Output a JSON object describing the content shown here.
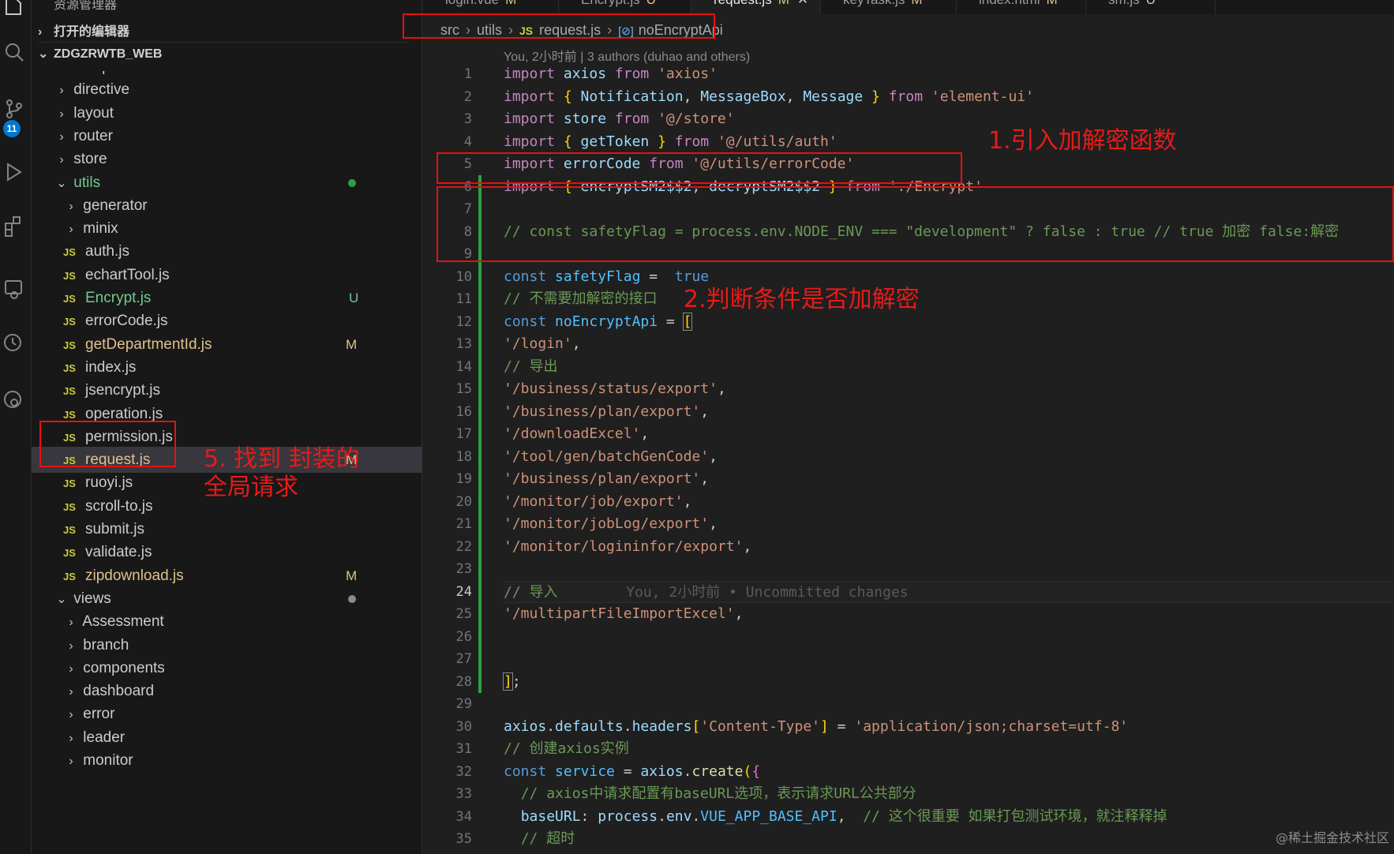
{
  "sidebar": {
    "title": "资源管理器",
    "open_editors": "打开的编辑器",
    "project": "ZDGZRWTB_WEB",
    "tree": [
      {
        "label": "components",
        "type": "folder",
        "depth": 1,
        "open": true
      },
      {
        "label": "directive",
        "type": "folder",
        "depth": 1,
        "open": false
      },
      {
        "label": "layout",
        "type": "folder",
        "depth": 1,
        "open": false
      },
      {
        "label": "router",
        "type": "folder",
        "depth": 1,
        "open": false
      },
      {
        "label": "store",
        "type": "folder",
        "depth": 1,
        "open": false
      },
      {
        "label": "utils",
        "type": "folder",
        "depth": 1,
        "open": true,
        "dot": true,
        "color": "green"
      },
      {
        "label": "generator",
        "type": "folder",
        "depth": 2,
        "open": false
      },
      {
        "label": "minix",
        "type": "folder",
        "depth": 2,
        "open": false
      },
      {
        "label": "auth.js",
        "type": "file",
        "depth": 2
      },
      {
        "label": "echartTool.js",
        "type": "file",
        "depth": 2
      },
      {
        "label": "Encrypt.js",
        "type": "file",
        "depth": 2,
        "status": "U"
      },
      {
        "label": "errorCode.js",
        "type": "file",
        "depth": 2
      },
      {
        "label": "getDepartmentId.js",
        "type": "file",
        "depth": 2,
        "status": "M"
      },
      {
        "label": "index.js",
        "type": "file",
        "depth": 2
      },
      {
        "label": "jsencrypt.js",
        "type": "file",
        "depth": 2
      },
      {
        "label": "operation.js",
        "type": "file",
        "depth": 2
      },
      {
        "label": "permission.js",
        "type": "file",
        "depth": 2
      },
      {
        "label": "request.js",
        "type": "file",
        "depth": 2,
        "status": "M",
        "selected": true
      },
      {
        "label": "ruoyi.js",
        "type": "file",
        "depth": 2
      },
      {
        "label": "scroll-to.js",
        "type": "file",
        "depth": 2
      },
      {
        "label": "submit.js",
        "type": "file",
        "depth": 2
      },
      {
        "label": "validate.js",
        "type": "file",
        "depth": 2
      },
      {
        "label": "zipdownload.js",
        "type": "file",
        "depth": 2,
        "status": "M"
      },
      {
        "label": "views",
        "type": "folder",
        "depth": 1,
        "open": true,
        "dot": true,
        "color": "grey"
      },
      {
        "label": "Assessment",
        "type": "folder",
        "depth": 2,
        "open": false
      },
      {
        "label": "branch",
        "type": "folder",
        "depth": 2,
        "open": false
      },
      {
        "label": "components",
        "type": "folder",
        "depth": 2,
        "open": false
      },
      {
        "label": "dashboard",
        "type": "folder",
        "depth": 2,
        "open": false
      },
      {
        "label": "error",
        "type": "folder",
        "depth": 2,
        "open": false
      },
      {
        "label": "leader",
        "type": "folder",
        "depth": 2,
        "open": false
      },
      {
        "label": "monitor",
        "type": "folder",
        "depth": 2,
        "open": false
      }
    ]
  },
  "activity": {
    "badge": "11"
  },
  "tabs": [
    {
      "label": "login.vue",
      "status": "M"
    },
    {
      "label": "Encrypt.js",
      "status": "U"
    },
    {
      "label": "request.js",
      "status": "M",
      "active": true,
      "close": "✕"
    },
    {
      "label": "keyTask.js",
      "status": "M"
    },
    {
      "label": "index.html",
      "status": "M"
    },
    {
      "label": "sm.js",
      "status": "U"
    }
  ],
  "breadcrumb": {
    "src": "src",
    "utils": "utils",
    "js_badge": "JS",
    "file": "request.js",
    "symbol_icon": "[⊘]",
    "symbol": "noEncryptApi"
  },
  "blame": "You, 2小时前 | 3 authors (duhao and others)",
  "current_line": 24,
  "code_lines": [
    [
      [
        "kw",
        "import "
      ],
      [
        "vr",
        "axios "
      ],
      [
        "kw",
        "from "
      ],
      [
        "st",
        "'axios'"
      ]
    ],
    [
      [
        "kw",
        "import "
      ],
      [
        "br",
        "{ "
      ],
      [
        "vr",
        "Notification"
      ],
      [
        "t",
        ", "
      ],
      [
        "vr",
        "MessageBox"
      ],
      [
        "t",
        ", "
      ],
      [
        "vr",
        "Message "
      ],
      [
        "br",
        "} "
      ],
      [
        "kw",
        "from "
      ],
      [
        "st",
        "'element-ui'"
      ]
    ],
    [
      [
        "kw",
        "import "
      ],
      [
        "vr",
        "store "
      ],
      [
        "kw",
        "from "
      ],
      [
        "st",
        "'@/store'"
      ]
    ],
    [
      [
        "kw",
        "import "
      ],
      [
        "br",
        "{ "
      ],
      [
        "vr",
        "getToken "
      ],
      [
        "br",
        "} "
      ],
      [
        "kw",
        "from "
      ],
      [
        "st",
        "'@/utils/auth'"
      ]
    ],
    [
      [
        "kw",
        "import "
      ],
      [
        "vr",
        "errorCode "
      ],
      [
        "kw",
        "from "
      ],
      [
        "st",
        "'@/utils/errorCode'"
      ]
    ],
    [
      [
        "kw",
        "import "
      ],
      [
        "br",
        "{ "
      ],
      [
        "vr",
        "encryptSM2$$2"
      ],
      [
        "t",
        ", "
      ],
      [
        "vr",
        "decryptSM2$$2 "
      ],
      [
        "br",
        "} "
      ],
      [
        "kw",
        "from "
      ],
      [
        "st",
        "'./Encrypt'"
      ]
    ],
    [],
    [
      [
        "cm",
        "// const safetyFlag = process.env.NODE_ENV === \"development\" ? false : true // true 加密 false:解密"
      ]
    ],
    [],
    [
      [
        "bl",
        "const "
      ],
      [
        "cst",
        "safetyFlag "
      ],
      [
        "t",
        "=  "
      ],
      [
        "bl",
        "true"
      ]
    ],
    [
      [
        "cm",
        "// 不需要加解密的接口"
      ]
    ],
    [
      [
        "bl",
        "const "
      ],
      [
        "cst",
        "noEncryptApi "
      ],
      [
        "t",
        "= "
      ],
      [
        "br",
        "["
      ]
    ],
    [
      [
        "st",
        "'/login'"
      ],
      [
        "t",
        ","
      ]
    ],
    [
      [
        "cm",
        "// 导出"
      ]
    ],
    [
      [
        "st",
        "'/business/status/export'"
      ],
      [
        "t",
        ","
      ]
    ],
    [
      [
        "st",
        "'/business/plan/export'"
      ],
      [
        "t",
        ","
      ]
    ],
    [
      [
        "st",
        "'/downloadExcel'"
      ],
      [
        "t",
        ","
      ]
    ],
    [
      [
        "st",
        "'/tool/gen/batchGenCode'"
      ],
      [
        "t",
        ","
      ]
    ],
    [
      [
        "st",
        "'/business/plan/export'"
      ],
      [
        "t",
        ","
      ]
    ],
    [
      [
        "st",
        "'/monitor/job/export'"
      ],
      [
        "t",
        ","
      ]
    ],
    [
      [
        "st",
        "'/monitor/jobLog/export'"
      ],
      [
        "t",
        ","
      ]
    ],
    [
      [
        "st",
        "'/monitor/logininfor/export'"
      ],
      [
        "t",
        ","
      ]
    ],
    [],
    [
      [
        "cm",
        "// 导入"
      ],
      [
        "ghost",
        "        You, 2小时前 • Uncommitted changes"
      ]
    ],
    [
      [
        "st",
        "'/multipartFileImportExcel'"
      ],
      [
        "t",
        ","
      ]
    ],
    [],
    [],
    [
      [
        "br",
        "]"
      ],
      [
        "t",
        ";"
      ]
    ],
    [],
    [
      [
        "vr",
        "axios"
      ],
      [
        "t",
        "."
      ],
      [
        "vr",
        "defaults"
      ],
      [
        "t",
        "."
      ],
      [
        "vr",
        "headers"
      ],
      [
        "br",
        "["
      ],
      [
        "st",
        "'Content-Type'"
      ],
      [
        "br",
        "]"
      ],
      [
        "t",
        " = "
      ],
      [
        "st",
        "'application/json;charset=utf-8'"
      ]
    ],
    [
      [
        "cm",
        "// 创建axios实例"
      ]
    ],
    [
      [
        "bl",
        "const "
      ],
      [
        "cst",
        "service "
      ],
      [
        "t",
        "= "
      ],
      [
        "vr",
        "axios"
      ],
      [
        "t",
        "."
      ],
      [
        "fn",
        "create"
      ],
      [
        "br",
        "("
      ],
      [
        "br2",
        "{"
      ]
    ],
    [
      [
        "t",
        "  "
      ],
      [
        "cm",
        "// axios中请求配置有baseURL选项，表示请求URL公共部分"
      ]
    ],
    [
      [
        "t",
        "  "
      ],
      [
        "vr",
        "baseURL"
      ],
      [
        "t",
        ": "
      ],
      [
        "vr",
        "process"
      ],
      [
        "t",
        "."
      ],
      [
        "vr",
        "env"
      ],
      [
        "t",
        "."
      ],
      [
        "cst",
        "VUE_APP_BASE_API"
      ],
      [
        "t",
        ",  "
      ],
      [
        "cm",
        "// 这个很重要 如果打包测试环境，就注释释掉"
      ]
    ],
    [
      [
        "t",
        "  "
      ],
      [
        "cm",
        "// 超时"
      ]
    ]
  ],
  "annotations": {
    "note1": "1.引入加解密函数",
    "note2": "2.判断条件是否加解密",
    "note5_line1": "5. 找到 封装的",
    "note5_line2": "全局请求"
  },
  "watermark": "@稀土掘金技术社区"
}
